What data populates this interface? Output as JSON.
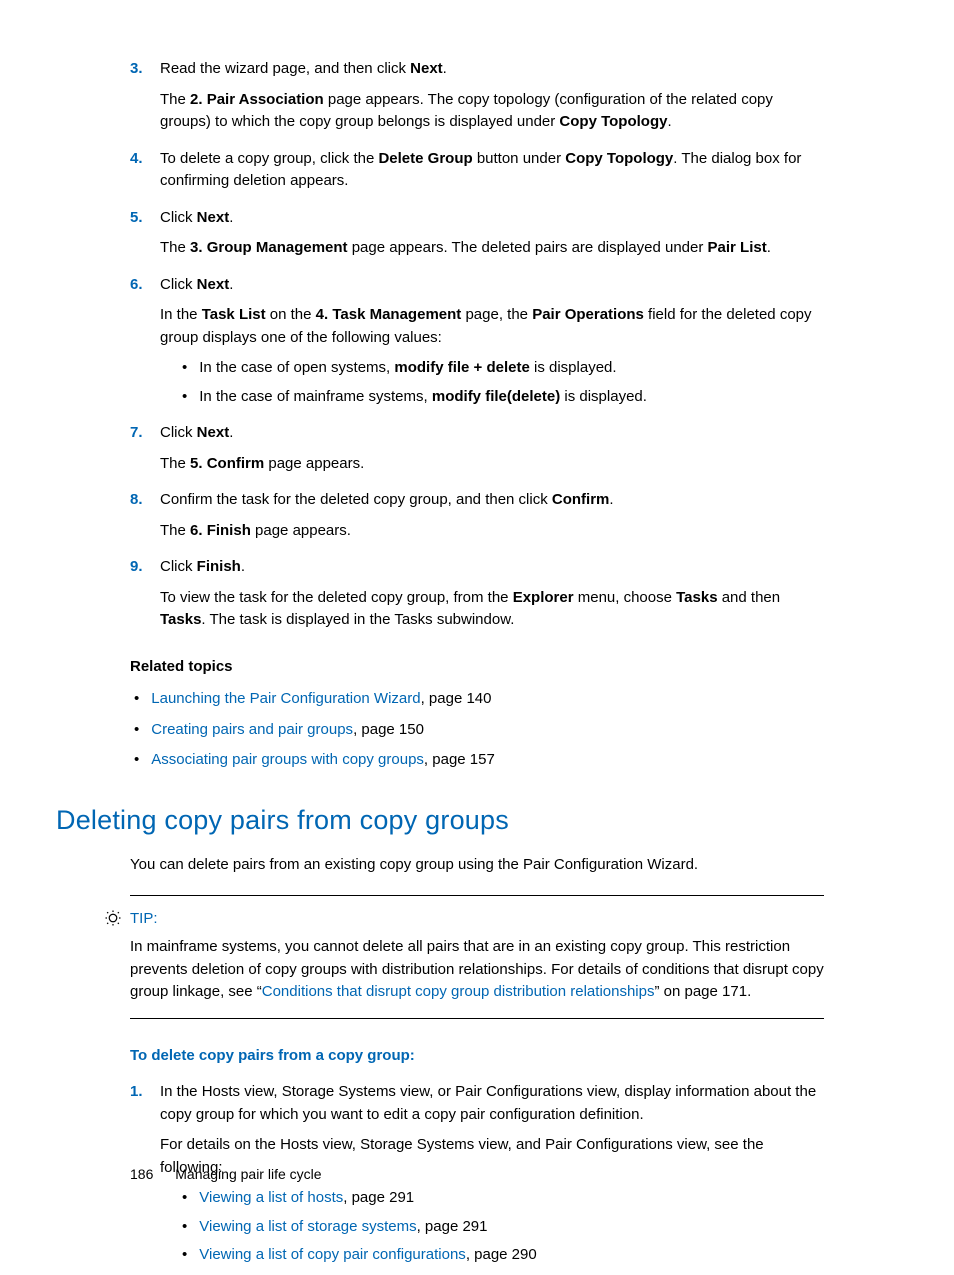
{
  "steps": {
    "3": {
      "num": "3.",
      "p1_a": "Read the wizard page, and then click ",
      "p1_b": "Next",
      "p1_c": ".",
      "p2_a": "The ",
      "p2_b": "2. Pair Association",
      "p2_c": " page appears. The copy topology (configuration of the related copy groups) to which the copy group belongs is displayed under ",
      "p2_d": "Copy Topology",
      "p2_e": "."
    },
    "4": {
      "num": "4.",
      "p1_a": "To delete a copy group, click the ",
      "p1_b": "Delete Group",
      "p1_c": " button under ",
      "p1_d": "Copy Topology",
      "p1_e": ". The dialog box for confirming deletion appears."
    },
    "5": {
      "num": "5.",
      "p1_a": "Click ",
      "p1_b": "Next",
      "p1_c": ".",
      "p2_a": "The ",
      "p2_b": "3. Group Management",
      "p2_c": " page appears. The deleted pairs are displayed under ",
      "p2_d": "Pair List",
      "p2_e": "."
    },
    "6": {
      "num": "6.",
      "p1_a": "Click ",
      "p1_b": "Next",
      "p1_c": ".",
      "p2_a": "In the ",
      "p2_b": "Task List",
      "p2_c": "  on the ",
      "p2_d": "4. Task Management",
      "p2_e": " page, the ",
      "p2_f": "Pair Operations",
      "p2_g": " field for the deleted copy group displays one of the following values:",
      "b1_a": "In the case of open systems, ",
      "b1_b": "modify file + delete",
      "b1_c": " is displayed.",
      "b2_a": "In the case of mainframe systems, ",
      "b2_b": "modify file(delete)",
      "b2_c": " is displayed."
    },
    "7": {
      "num": "7.",
      "p1_a": "Click ",
      "p1_b": "Next",
      "p1_c": ".",
      "p2_a": "The ",
      "p2_b": "5. Confirm",
      "p2_c": " page appears."
    },
    "8": {
      "num": "8.",
      "p1_a": "Confirm the task for the deleted copy group, and then click ",
      "p1_b": "Confirm",
      "p1_c": ".",
      "p2_a": "The ",
      "p2_b": "6. Finish",
      "p2_c": " page appears."
    },
    "9": {
      "num": "9.",
      "p1_a": "Click ",
      "p1_b": "Finish",
      "p1_c": ".",
      "p2_a": "To view the task for the deleted copy group, from the ",
      "p2_b": "Explorer",
      "p2_c": " menu, choose ",
      "p2_d": "Tasks",
      "p2_e": " and then ",
      "p2_f": "Tasks",
      "p2_g": ". The task is displayed in the Tasks subwindow."
    }
  },
  "related": {
    "heading": "Related topics",
    "items": [
      {
        "link": "Launching the Pair Configuration Wizard",
        "suffix": ", page 140"
      },
      {
        "link": "Creating pairs and pair groups",
        "suffix": ", page 150"
      },
      {
        "link": "Associating pair groups with copy groups",
        "suffix": ", page 157"
      }
    ]
  },
  "section": {
    "heading": "Deleting copy pairs from copy groups",
    "intro": "You can delete pairs from an existing copy group using the Pair Configuration Wizard."
  },
  "tip": {
    "label": "TIP:",
    "text_a": "In mainframe systems, you cannot delete all pairs that are in an existing copy group. This restriction prevents deletion of copy groups with distribution relationships. For details of conditions that disrupt copy group linkage, see “",
    "link": "Conditions that disrupt copy group distribution relationships",
    "text_b": "” on page 171."
  },
  "proc": {
    "heading": "To delete copy pairs from a copy group:",
    "step1": {
      "num": "1.",
      "p1": "In the Hosts view, Storage Systems view, or Pair Configurations view, display information about the copy group for which you want to edit a copy pair configuration definition.",
      "p2": "For details on the Hosts view, Storage Systems view, and Pair Configurations view, see the following:",
      "bullets": [
        {
          "link": "Viewing a list of hosts",
          "suffix": ", page 291"
        },
        {
          "link": "Viewing a list of storage systems",
          "suffix": ", page 291"
        },
        {
          "link": "Viewing a list of copy pair configurations",
          "suffix": ", page 290"
        }
      ]
    }
  },
  "footer": {
    "page": "186",
    "chapter": "Managing pair life cycle"
  }
}
